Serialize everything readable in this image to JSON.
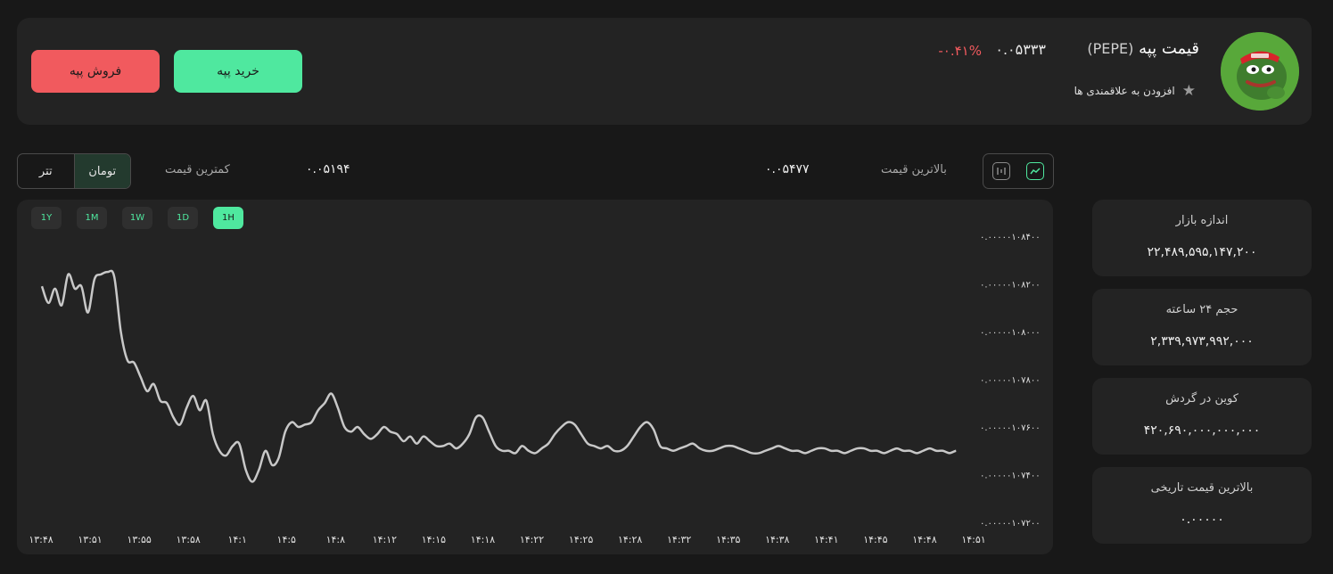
{
  "coin": {
    "name": "قیمت پپه",
    "symbol": "(PEPE)",
    "price": "۰.۰۵۳۳۳",
    "change": "-۰.۴۱%",
    "favorite_label": "افزودن به علاقمندی ها",
    "avatar_icon": "pepe-frog-avatar"
  },
  "actions": {
    "sell_label": "فروش پپه",
    "buy_label": "خرید پپه"
  },
  "currency": {
    "tether_label": "تتر",
    "toman_label": "تومان",
    "selected": "تومان"
  },
  "stats": {
    "low_label": "کمترین قیمت",
    "low_value": "۰.۰۵۱۹۴",
    "high_label": "بالاترین قیمت",
    "high_value": "۰.۰۵۴۷۷"
  },
  "ranges": [
    {
      "label": "1Y",
      "active": false
    },
    {
      "label": "1M",
      "active": false
    },
    {
      "label": "1W",
      "active": false
    },
    {
      "label": "1D",
      "active": false
    },
    {
      "label": "1H",
      "active": true
    }
  ],
  "side": [
    {
      "label": "اندازه بازار",
      "value": "۲۲,۴۸۹,۵۹۵,۱۴۷,۲۰۰"
    },
    {
      "label": "حجم ۲۴ ساعته",
      "value": "۲,۳۳۹,۹۷۳,۹۹۲,۰۰۰"
    },
    {
      "label": "کوین در گردش",
      "value": "۴۲۰,۶۹۰,۰۰۰,۰۰۰,۰۰۰"
    },
    {
      "label": "بالاترین قیمت تاریخی",
      "value": "۰.۰۰۰۰۰"
    }
  ],
  "colors": {
    "accent": "#4fe89f",
    "negative": "#f15a5e",
    "line": "#c8c8c8"
  },
  "chart_data": {
    "type": "line",
    "y_tick_labels": [
      "۰.۰۰۰۰۰۱۰۸۴۰۰",
      "۰.۰۰۰۰۰۱۰۸۲۰۰",
      "۰.۰۰۰۰۰۱۰۸۰۰۰",
      "۰.۰۰۰۰۰۱۰۷۸۰۰",
      "۰.۰۰۰۰۰۱۰۷۶۰۰",
      "۰.۰۰۰۰۰۱۰۷۴۰۰",
      "۰.۰۰۰۰۰۱۰۷۲۰۰"
    ],
    "y_ticks": [
      1.084e-06,
      1.082e-06,
      1.08e-06,
      1.078e-06,
      1.076e-06,
      1.074e-06,
      1.072e-06
    ],
    "ylim": [
      1.072e-06,
      1.084e-06
    ],
    "x_tick_labels": [
      "۱۳:۴۸",
      "۱۳:۵۱",
      "۱۳:۵۵",
      "۱۳:۵۸",
      "۱۴:۱",
      "۱۴:۵",
      "۱۴:۸",
      "۱۴:۱۲",
      "۱۴:۱۵",
      "۱۴:۱۸",
      "۱۴:۲۲",
      "۱۴:۲۵",
      "۱۴:۲۸",
      "۱۴:۳۲",
      "۱۴:۳۵",
      "۱۴:۳۸",
      "۱۴:۴۱",
      "۱۴:۴۵",
      "۱۴:۴۸",
      "۱۴:۵۱"
    ],
    "x": [
      0,
      0.4,
      0.8,
      1.2,
      1.6,
      2.0,
      2.4,
      2.8,
      3.2,
      3.6,
      4.0,
      4.4,
      4.8,
      5.2,
      5.6,
      6.0,
      6.4,
      6.8,
      7.2,
      7.6,
      8.0,
      8.4,
      8.8,
      9.2,
      9.6,
      10.0,
      10.4,
      10.8,
      11.2,
      11.6,
      12.0,
      12.4,
      12.8,
      13.2,
      13.6,
      14.0,
      14.4,
      14.8,
      15.2,
      15.6,
      16.0,
      16.4,
      16.8,
      17.2,
      17.6,
      18.0,
      18.4,
      18.8,
      19.2,
      19.6,
      20.0,
      20.4,
      20.8,
      21.2,
      21.6,
      22.0,
      22.4,
      22.8,
      23.2,
      23.6,
      24.0,
      24.4,
      24.8,
      25.2,
      25.6,
      26.0,
      26.4,
      26.8,
      27.2,
      27.6,
      28.0,
      28.4,
      28.8,
      29.2,
      29.6,
      30.0,
      30.4,
      30.8,
      31.2,
      31.6,
      32.0,
      32.4,
      32.8,
      33.2,
      33.6,
      34.0,
      34.4,
      34.8,
      35.2,
      35.6,
      36.0,
      36.4,
      36.8,
      37.2,
      37.6,
      38.0,
      38.4,
      38.8,
      39.2,
      39.6,
      40.0,
      40.4,
      40.8,
      41.2,
      41.6,
      42.0,
      42.4,
      42.8,
      43.2,
      43.6,
      44.0,
      44.4,
      44.8,
      45.2,
      45.6,
      46.0,
      46.4,
      46.8,
      47.2,
      47.6,
      48.0,
      48.4,
      48.8,
      49.2,
      49.6,
      50.0,
      50.4,
      50.8,
      51.2,
      51.6,
      52.0,
      52.4,
      52.8,
      53.2,
      53.6,
      54.0,
      54.4,
      54.8,
      55.2,
      55.6,
      56.0,
      56.4
    ],
    "values": [
      1.0819e-06,
      1.0812e-06,
      1.0818e-06,
      1.0811e-06,
      1.0824e-06,
      1.0818e-06,
      1.0819e-06,
      1.0808e-06,
      1.0822e-06,
      1.0824e-06,
      1.0825e-06,
      1.0823e-06,
      1.08e-06,
      1.0788e-06,
      1.0787e-06,
      1.0781e-06,
      1.0775e-06,
      1.0778e-06,
      1.0771e-06,
      1.077e-06,
      1.0764e-06,
      1.0761e-06,
      1.0768e-06,
      1.0773e-06,
      1.0767e-06,
      1.0771e-06,
      1.0757e-06,
      1.075e-06,
      1.0748e-06,
      1.0752e-06,
      1.0753e-06,
      1.0742e-06,
      1.0737e-06,
      1.0742e-06,
      1.075e-06,
      1.0744e-06,
      1.0747e-06,
      1.0758e-06,
      1.0762e-06,
      1.076e-06,
      1.0761e-06,
      1.0762e-06,
      1.0767e-06,
      1.077e-06,
      1.0774e-06,
      1.0768e-06,
      1.076e-06,
      1.0758e-06,
      1.076e-06,
      1.0757e-06,
      1.0755e-06,
      1.0757e-06,
      1.076e-06,
      1.0758e-06,
      1.0757e-06,
      1.0754e-06,
      1.0756e-06,
      1.0753e-06,
      1.0756e-06,
      1.0754e-06,
      1.0752e-06,
      1.0752e-06,
      1.0753e-06,
      1.0751e-06,
      1.0753e-06,
      1.0757e-06,
      1.0764e-06,
      1.0764e-06,
      1.0758e-06,
      1.0752e-06,
      1.075e-06,
      1.075e-06,
      1.0749e-06,
      1.0752e-06,
      1.075e-06,
      1.0749e-06,
      1.0751e-06,
      1.0753e-06,
      1.0757e-06,
      1.076e-06,
      1.0762e-06,
      1.0761e-06,
      1.0757e-06,
      1.0753e-06,
      1.0752e-06,
      1.0751e-06,
      1.0752e-06,
      1.075e-06,
      1.075e-06,
      1.0752e-06,
      1.0756e-06,
      1.076e-06,
      1.0762e-06,
      1.0759e-06,
      1.0752e-06,
      1.0751e-06,
      1.075e-06,
      1.0751e-06,
      1.0752e-06,
      1.0753e-06,
      1.0751e-06,
      1.075e-06,
      1.075e-06,
      1.0751e-06,
      1.0752e-06,
      1.0752e-06,
      1.0751e-06,
      1.075e-06,
      1.0749e-06,
      1.0749e-06,
      1.075e-06,
      1.0751e-06,
      1.0752e-06,
      1.0751e-06,
      1.075e-06,
      1.075e-06,
      1.0749e-06,
      1.075e-06,
      1.0751e-06,
      1.0751e-06,
      1.075e-06,
      1.075e-06,
      1.0749e-06,
      1.075e-06,
      1.0751e-06,
      1.0751e-06,
      1.075e-06,
      1.075e-06,
      1.0749e-06,
      1.075e-06,
      1.0751e-06,
      1.075e-06,
      1.075e-06,
      1.0749e-06,
      1.075e-06,
      1.0751e-06,
      1.075e-06,
      1.075e-06,
      1.0749e-06,
      1.075e-06,
      1.075e-06
    ],
    "grid": false,
    "legend": "none"
  }
}
